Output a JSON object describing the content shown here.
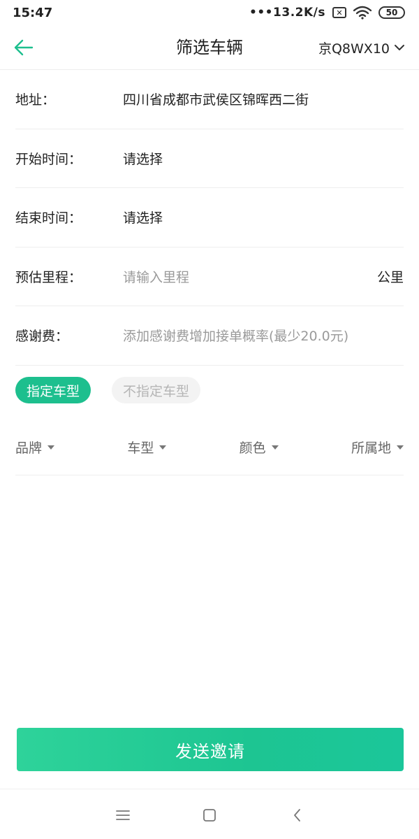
{
  "status_bar": {
    "time": "15:47",
    "network_speed": "•••13.2K/s",
    "sim_icon_glyph": "✕",
    "battery_level": "50"
  },
  "header": {
    "title": "筛选车辆",
    "plate": "京Q8WX10",
    "back_icon": "arrow-left-icon",
    "accent_color": "#1dbf8e"
  },
  "form": {
    "rows": [
      {
        "label": "地址：",
        "value": "四川省成都市武侯区锦晖西二街",
        "placeholder": false
      },
      {
        "label": "开始时间：",
        "value": "请选择",
        "placeholder": false
      },
      {
        "label": "结束时间：",
        "value": "请选择",
        "placeholder": false
      },
      {
        "label": "预估里程：",
        "value": "请输入里程",
        "placeholder": true,
        "unit": "公里"
      },
      {
        "label": "感谢费：",
        "value": "添加感谢费增加接单概率(最少20.0元)",
        "placeholder": true
      }
    ]
  },
  "chips": {
    "specified": "指定车型",
    "unspecified": "不指定车型"
  },
  "filters": [
    {
      "label": "品牌"
    },
    {
      "label": "车型"
    },
    {
      "label": "颜色"
    },
    {
      "label": "所属地"
    }
  ],
  "submit": {
    "label": "发送邀请"
  },
  "nav_bar": {
    "menu_icon": "menu-icon",
    "home_icon": "home-square-icon",
    "back_icon": "nav-back-icon"
  }
}
